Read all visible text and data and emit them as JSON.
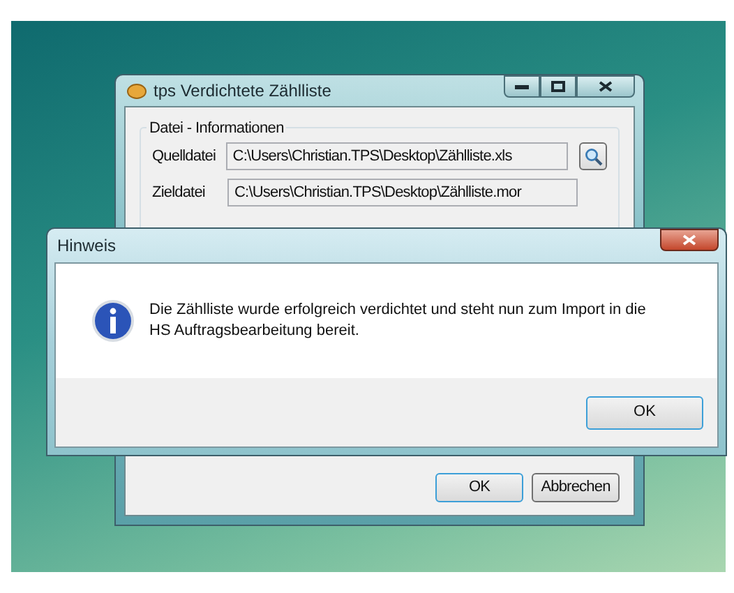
{
  "main_window": {
    "title": "tps Verdichtete Zählliste",
    "group": {
      "title": "Datei - Informationen",
      "fields": [
        {
          "label": "Quelldatei",
          "value": "C:\\Users\\Christian.TPS\\Desktop\\Zählliste.xls",
          "browse": true
        },
        {
          "label": "Zieldatei",
          "value": "C:\\Users\\Christian.TPS\\Desktop\\Zählliste.mor",
          "browse": false
        }
      ]
    },
    "buttons": [
      {
        "label": "OK",
        "default": true
      },
      {
        "label": "Abbrechen",
        "default": false
      }
    ]
  },
  "dialog": {
    "title": "Hinweis",
    "message": "Die Zählliste wurde erfolgreich verdichtet und steht nun zum Import in die HS Auftragsbearbeitung bereit.",
    "button": "OK"
  }
}
